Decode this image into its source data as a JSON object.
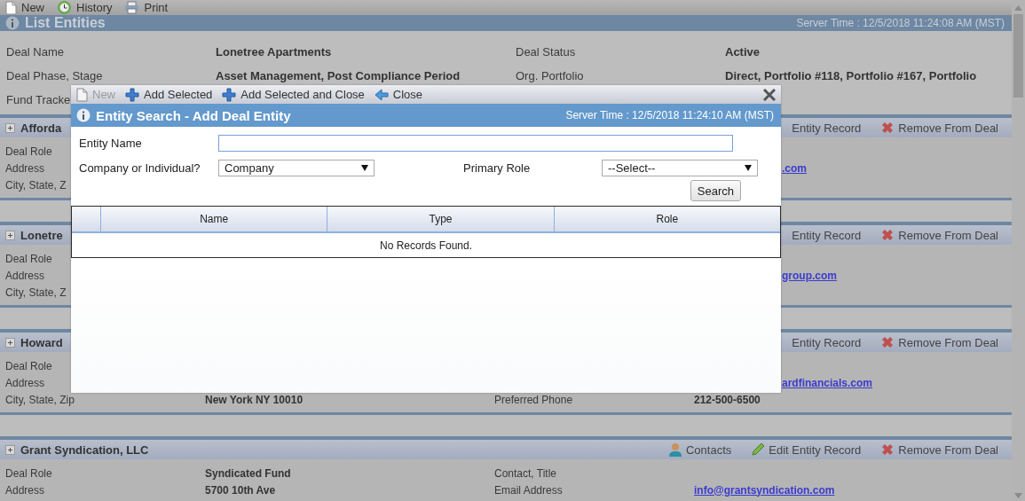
{
  "toolbar": [
    {
      "label": "New",
      "kind": "new"
    },
    {
      "label": "History",
      "kind": "history"
    },
    {
      "label": "Print",
      "kind": "print"
    }
  ],
  "header": {
    "title": "List Entities",
    "server_time": "Server Time : 12/5/2018 11:24:08 AM (MST)"
  },
  "deal_info": [
    {
      "label": "Deal Name",
      "value": "Lonetree Apartments",
      "label2": "Deal Status",
      "value2": "Active"
    },
    {
      "label": "Deal Phase, Stage",
      "value": "Asset Management, Post Compliance Period",
      "label2": "Org. Portfolio",
      "value2": "Direct, Portfolio #118, Portfolio #167, Portfolio"
    },
    {
      "label": "Fund Tracke"
    }
  ],
  "entities": [
    {
      "title": "Afforda",
      "actions": [
        {
          "label": "Entity Record",
          "kind": "plain"
        },
        {
          "label": "Remove From Deal",
          "kind": "remove"
        }
      ],
      "rows": [
        {
          "kind": "covered",
          "label": "Deal Role"
        },
        {
          "kind": "covered",
          "label": "Address",
          "link": ".com"
        },
        {
          "kind": "covered",
          "label": "City, State, Z"
        }
      ]
    },
    {
      "title": "Lonetre",
      "actions": [
        {
          "label": "Entity Record",
          "kind": "plain"
        },
        {
          "label": "Remove From Deal",
          "kind": "remove"
        }
      ],
      "rows": [
        {
          "kind": "covered",
          "label": "Deal Role"
        },
        {
          "kind": "covered",
          "label": "Address",
          "link": "group.com"
        },
        {
          "kind": "covered",
          "label": "City, State, Z"
        }
      ]
    },
    {
      "title": "Howard",
      "actions": [
        {
          "label": "Entity Record",
          "kind": "plain"
        },
        {
          "label": "Remove From Deal",
          "kind": "remove"
        }
      ],
      "rows": [
        {
          "kind": "covered",
          "label": "Deal Role"
        },
        {
          "kind": "covered",
          "label": "Address",
          "link": "ardfinancials.com"
        },
        {
          "kind": "full",
          "label": "City, State, Zip",
          "value": "New York NY 10010",
          "label2": "Preferred Phone",
          "value2": "212-500-6500"
        }
      ]
    },
    {
      "title": "Grant Syndication, LLC",
      "actions": [
        {
          "label": "Contacts",
          "kind": "contacts"
        },
        {
          "label": "Edit Entity Record",
          "kind": "edit"
        },
        {
          "label": "Remove From Deal",
          "kind": "remove"
        }
      ],
      "rows": [
        {
          "kind": "full",
          "label": "Deal Role",
          "value": "Syndicated Fund",
          "label2": "Contact, Title"
        },
        {
          "kind": "full",
          "label": "Address",
          "value": "5700 10th Ave",
          "label2": "Email Address",
          "link": "info@grantsyndication.com"
        }
      ]
    }
  ],
  "dialog": {
    "toolbar": [
      {
        "label": "New",
        "kind": "new",
        "disabled": true
      },
      {
        "label": "Add Selected",
        "kind": "add",
        "disabled": false
      },
      {
        "label": "Add Selected and Close",
        "kind": "add",
        "disabled": false
      },
      {
        "label": "Close",
        "kind": "back",
        "disabled": false
      }
    ],
    "title": "Entity Search - Add Deal Entity",
    "server_time": "Server Time : 12/5/2018 11:24:10 AM (MST)",
    "entity_name": {
      "label": "Entity Name"
    },
    "company_or_individual": {
      "label": "Company or Individual?",
      "value": "Company"
    },
    "primary_role": {
      "label": "Primary Role",
      "value": "--Select--"
    },
    "search_button": "Search",
    "table": {
      "columns": [
        "Name",
        "Type",
        "Role"
      ],
      "empty_text": "No Records Found."
    }
  }
}
